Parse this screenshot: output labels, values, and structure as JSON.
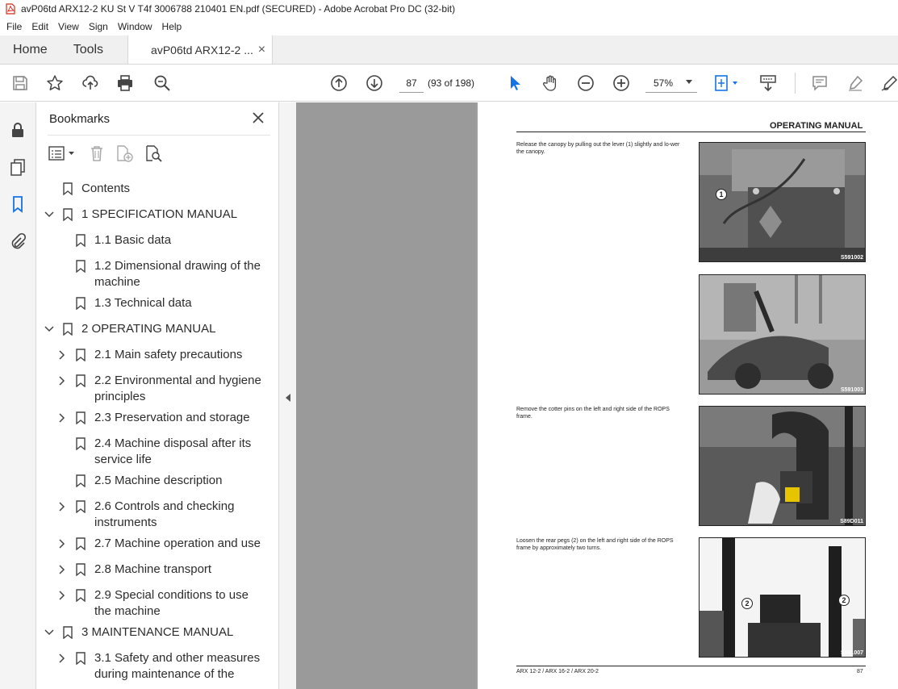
{
  "window": {
    "title": "avP06td ARX12-2 KU St V T4f 3006788 210401 EN.pdf (SECURED) - Adobe Acrobat Pro DC (32-bit)"
  },
  "menu": [
    "File",
    "Edit",
    "View",
    "Sign",
    "Window",
    "Help"
  ],
  "tabs": {
    "home": "Home",
    "tools": "Tools",
    "doc": "avP06td ARX12-2 ...",
    "close": "×"
  },
  "toolbar": {
    "page_number": "87",
    "page_count": "(93 of 198)",
    "zoom": "57%"
  },
  "bookmarks": {
    "title": "Bookmarks",
    "items": [
      {
        "label": "Contents",
        "level": 0,
        "chevron": "none"
      },
      {
        "label": "1 SPECIFICATION MANUAL",
        "level": 0,
        "chevron": "down"
      },
      {
        "label": "1.1 Basic data",
        "level": 1,
        "chevron": "none"
      },
      {
        "label": "1.2 Dimensional drawing of the",
        "label2": "machine",
        "level": 1,
        "chevron": "none"
      },
      {
        "label": "1.3 Technical data",
        "level": 1,
        "chevron": "none"
      },
      {
        "label": "2 OPERATING MANUAL",
        "level": 0,
        "chevron": "down"
      },
      {
        "label": "2.1 Main safety precautions",
        "level": 1,
        "chevron": "right"
      },
      {
        "label": "2.2 Environmental and hygiene",
        "label2": "principles",
        "level": 1,
        "chevron": "right"
      },
      {
        "label": "2.3 Preservation and storage",
        "level": 1,
        "chevron": "right"
      },
      {
        "label": "2.4 Machine disposal after its",
        "label2": "service life",
        "level": 1,
        "chevron": "none"
      },
      {
        "label": "2.5 Machine description",
        "level": 1,
        "chevron": "none"
      },
      {
        "label": "2.6 Controls and checking",
        "label2": "instruments",
        "level": 1,
        "chevron": "right"
      },
      {
        "label": "2.7 Machine operation and use",
        "level": 1,
        "chevron": "right"
      },
      {
        "label": "2.8 Machine transport",
        "level": 1,
        "chevron": "right"
      },
      {
        "label": "2.9 Special conditions to use",
        "label2": "the machine",
        "level": 1,
        "chevron": "right"
      },
      {
        "label": "3 MAINTENANCE MANUAL",
        "level": 0,
        "chevron": "down"
      },
      {
        "label": "3.1 Safety and other measures",
        "label2": "during maintenance of the",
        "level": 1,
        "chevron": "right"
      }
    ]
  },
  "document": {
    "header": "OPERATING MANUAL",
    "steps": [
      {
        "text": "Release the canopy by pulling out the lever (1) slightly and lo-wer the canopy.",
        "photo_label": "S591002",
        "callout": "1"
      },
      {
        "text": "",
        "photo_label": "S591003",
        "callout": ""
      },
      {
        "text": "Remove the cotter pins on the left and right side of the ROPS frame.",
        "photo_label": "S89D011",
        "callout": ""
      },
      {
        "text": "Loosen the rear pegs (2) on the left and right side of the ROPS frame by approximately two turns.",
        "photo_label": "S591007",
        "callout": "2"
      }
    ],
    "footer_left": "ARX 12-2 / ARX 16-2 / ARX 20-2",
    "footer_right": "87"
  },
  "colors": {
    "accent": "#1473e6",
    "viewer_bg": "#9e9e9e"
  }
}
